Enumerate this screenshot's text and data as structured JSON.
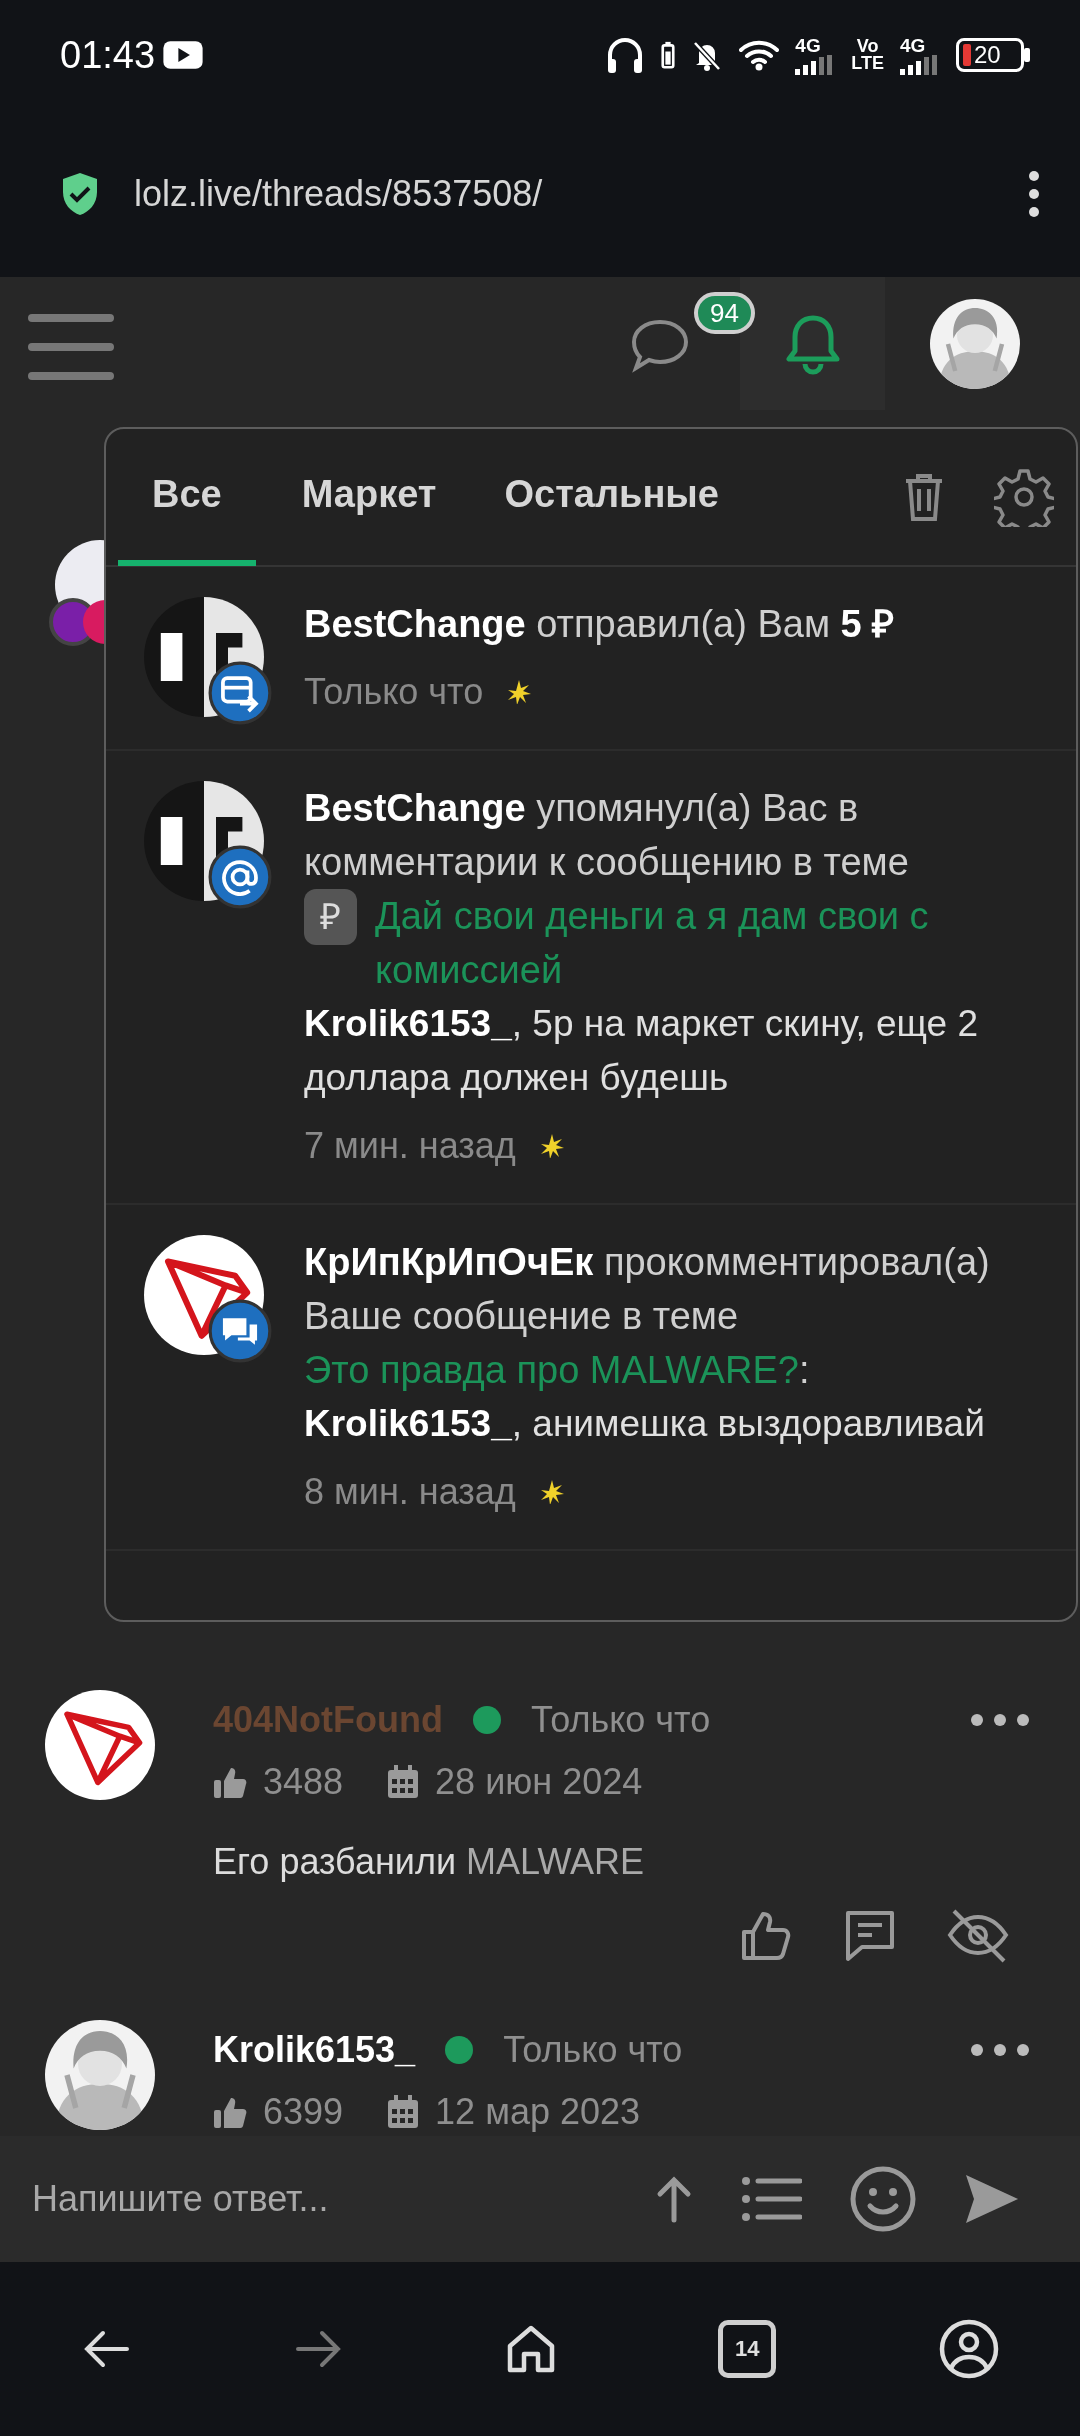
{
  "status_bar": {
    "time": "01:43",
    "sim1": "4G",
    "volte": [
      "Vo",
      "LTE"
    ],
    "sim2": "4G",
    "battery": "20"
  },
  "browser": {
    "url": "lolz.live/threads/8537508/"
  },
  "header": {
    "messages_badge": "94"
  },
  "notifications_popup": {
    "tabs": [
      {
        "label": "Все",
        "selected": true
      },
      {
        "label": "Маркет",
        "selected": false
      },
      {
        "label": "Остальные",
        "selected": false
      }
    ],
    "items": [
      {
        "avatar": {
          "kind": "split"
        },
        "badge": {
          "kind": "transfer"
        },
        "text": "**BestChange** отправил(а) Вам **5 ₽**",
        "time": "Только что",
        "unread": true
      },
      {
        "avatar": {
          "kind": "split"
        },
        "badge": {
          "kind": "mention"
        },
        "text": "**BestChange** упомянул(а) Вас в комментарии к сообщению в теме",
        "chip": "₽",
        "link": "Дай свои деньги а я дам свои с комиссией",
        "comment": "**Krolik6153_**, 5р на маркет скину, еще 2 доллара должен будешь",
        "time": "7 мин. назад",
        "unread": true
      },
      {
        "avatar": {
          "kind": "tron"
        },
        "badge": {
          "kind": "comment"
        },
        "text": "**КрИпКрИпОчЕк** прокомментировал(а) Ваше сообщение в теме",
        "link": "Это правда про MALWARE?",
        "link_suffix": ":",
        "comment": "**Krolik6153_**, анимешка выздоравливай",
        "time": "8 мин. назад",
        "unread": true
      }
    ]
  },
  "posts": [
    {
      "avatar": {
        "kind": "tron"
      },
      "author": "404NotFound",
      "color": "#6b4631",
      "online": true,
      "time": "Только что",
      "likes": "3488",
      "joined": "28 июн 2024",
      "text": "Его разбанили",
      "link": "MALWARE",
      "actions": true
    },
    {
      "avatar": {
        "kind": "figure"
      },
      "author": "Krolik6153_",
      "color": "#ffffff",
      "online": true,
      "time": "Только что",
      "likes": "6399",
      "joined": "12 мар 2023"
    }
  ],
  "composer": {
    "placeholder": "Напишите ответ..."
  },
  "nav": {
    "tabs_count": "14"
  }
}
